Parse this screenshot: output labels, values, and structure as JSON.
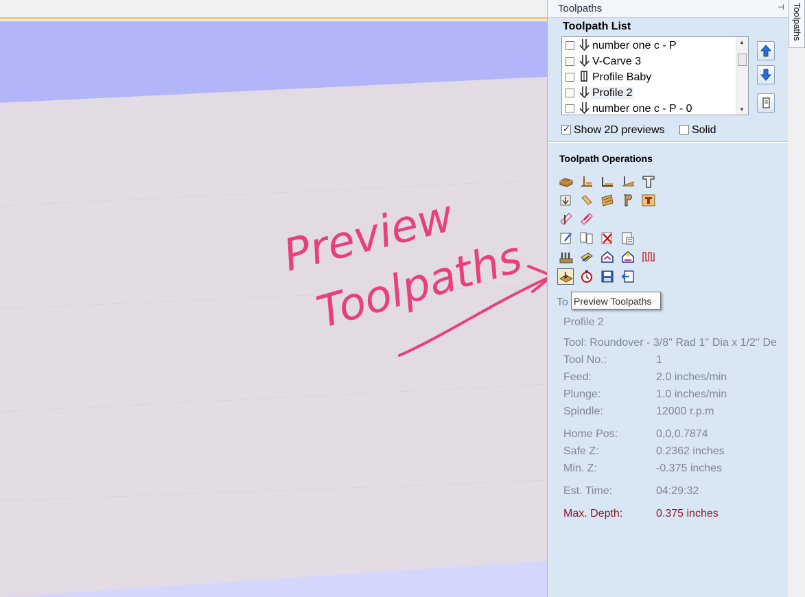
{
  "panel": {
    "title": "Toolpaths",
    "side_tab": "Toolpaths",
    "toolpath_list_heading": "Toolpath List",
    "toolpaths": [
      {
        "label": "number one c - P",
        "checked": false,
        "icon": "down-arrow-icon"
      },
      {
        "label": "V-Carve 3",
        "checked": false,
        "icon": "down-arrow-icon"
      },
      {
        "label": "Profile Baby",
        "checked": false,
        "icon": "profile-icon"
      },
      {
        "label": "Profile 2",
        "checked": false,
        "icon": "down-arrow-icon",
        "selected": true
      },
      {
        "label": "number one c - P - 0",
        "checked": false,
        "icon": "down-arrow-icon"
      }
    ],
    "show_2d_previews": {
      "label": "Show 2D previews",
      "checked": true
    },
    "solid": {
      "label": "Solid",
      "checked": false
    },
    "operations_heading": "Toolpath Operations",
    "operations_rows": [
      [
        "pocket-3d-icon",
        "profile-icon",
        "pocket-icon",
        "drill-icon",
        "text-t-icon"
      ],
      [
        "moulding-icon",
        "inlay-icon",
        "texture-icon",
        "prism-icon",
        "vcarve-t-icon"
      ],
      [
        "fluting-icon",
        "quick-engrave-icon"
      ],
      [
        "edit-gcode-icon",
        "merge-gcode-icon",
        "delete-icon",
        "calculator-icon"
      ],
      [
        "tool-database-icon",
        "material-setup-icon",
        "template-icon",
        "rotary-icon",
        "tabs-icon"
      ],
      [
        "preview-toolpaths-icon",
        "time-estimate-icon",
        "save-toolpath-icon",
        "export-icon"
      ]
    ],
    "tooltip": "Preview Toolpaths",
    "hidden_label_fragment": "To"
  },
  "details": {
    "name": "Profile 2",
    "tool": "Tool: Roundover - 3/8'' Rad 1'' Dia x 1/2'' De",
    "tool_no_label": "Tool No.:",
    "tool_no": "1",
    "feed_label": "Feed:",
    "feed": "2.0 inches/min",
    "plunge_label": "Plunge:",
    "plunge": "1.0 inches/min",
    "spindle_label": "Spindle:",
    "spindle": "12000 r.p.m",
    "home_label": "Home Pos:",
    "home": "0,0,0.7874",
    "safe_z_label": "Safe Z:",
    "safe_z": "0.2362 inches",
    "min_z_label": "Min. Z:",
    "min_z": "-0.375 inches",
    "est_time_label": "Est. Time:",
    "est_time": "04:29:32",
    "max_depth_label": "Max. Depth:",
    "max_depth": "0.375 inches"
  },
  "annotation": {
    "line1": "Preview",
    "line2": "Toolpaths",
    "color": "#e8407a"
  }
}
